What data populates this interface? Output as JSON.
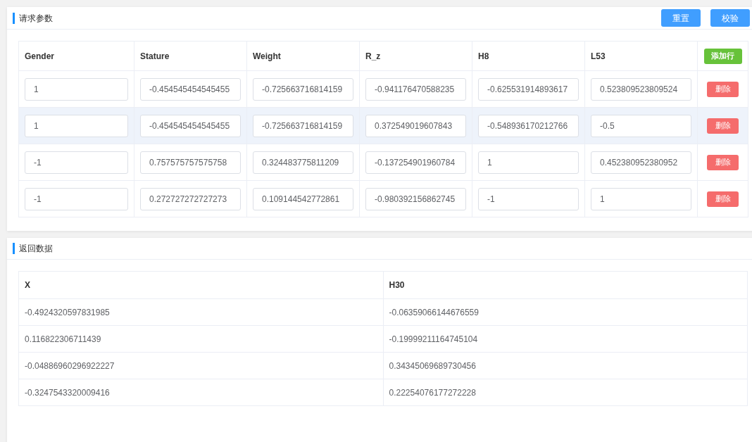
{
  "request_panel": {
    "title": "请求参数",
    "buttons": [
      "重置",
      "校验"
    ],
    "table": {
      "columns": [
        "Gender",
        "Stature",
        "Weight",
        "R_z",
        "H8",
        "L53"
      ],
      "add_row_button": "添加行",
      "rows": [
        {
          "values": [
            "1",
            "-0.454545454545455",
            "-0.725663716814159",
            "-0.941176470588235",
            "-0.625531914893617",
            "0.523809523809524"
          ],
          "delete_button": "删除",
          "hovered": false
        },
        {
          "values": [
            "1",
            "-0.454545454545455",
            "-0.725663716814159",
            "0.372549019607843",
            "-0.548936170212766",
            "-0.5"
          ],
          "delete_button": "删除",
          "hovered": true
        },
        {
          "values": [
            "-1",
            "0.757575757575758",
            "0.324483775811209",
            "-0.137254901960784",
            "1",
            "0.452380952380952"
          ],
          "delete_button": "删除",
          "hovered": false
        },
        {
          "values": [
            "-1",
            "0.272727272727273",
            "0.109144542772861",
            "-0.980392156862745",
            "-1",
            "1"
          ],
          "delete_button": "删除",
          "hovered": false
        }
      ]
    }
  },
  "response_panel": {
    "title": "返回数据",
    "table": {
      "columns": [
        "X",
        "H30"
      ],
      "rows": [
        [
          "-0.4924320597831985",
          "-0.06359066144676559"
        ],
        [
          "0.116822306711439",
          "-0.19999211164745104"
        ],
        [
          "-0.04886960296922227",
          "0.34345069689730456"
        ],
        [
          "-0.3247543320009416",
          "0.22254076177272228"
        ]
      ]
    }
  }
}
